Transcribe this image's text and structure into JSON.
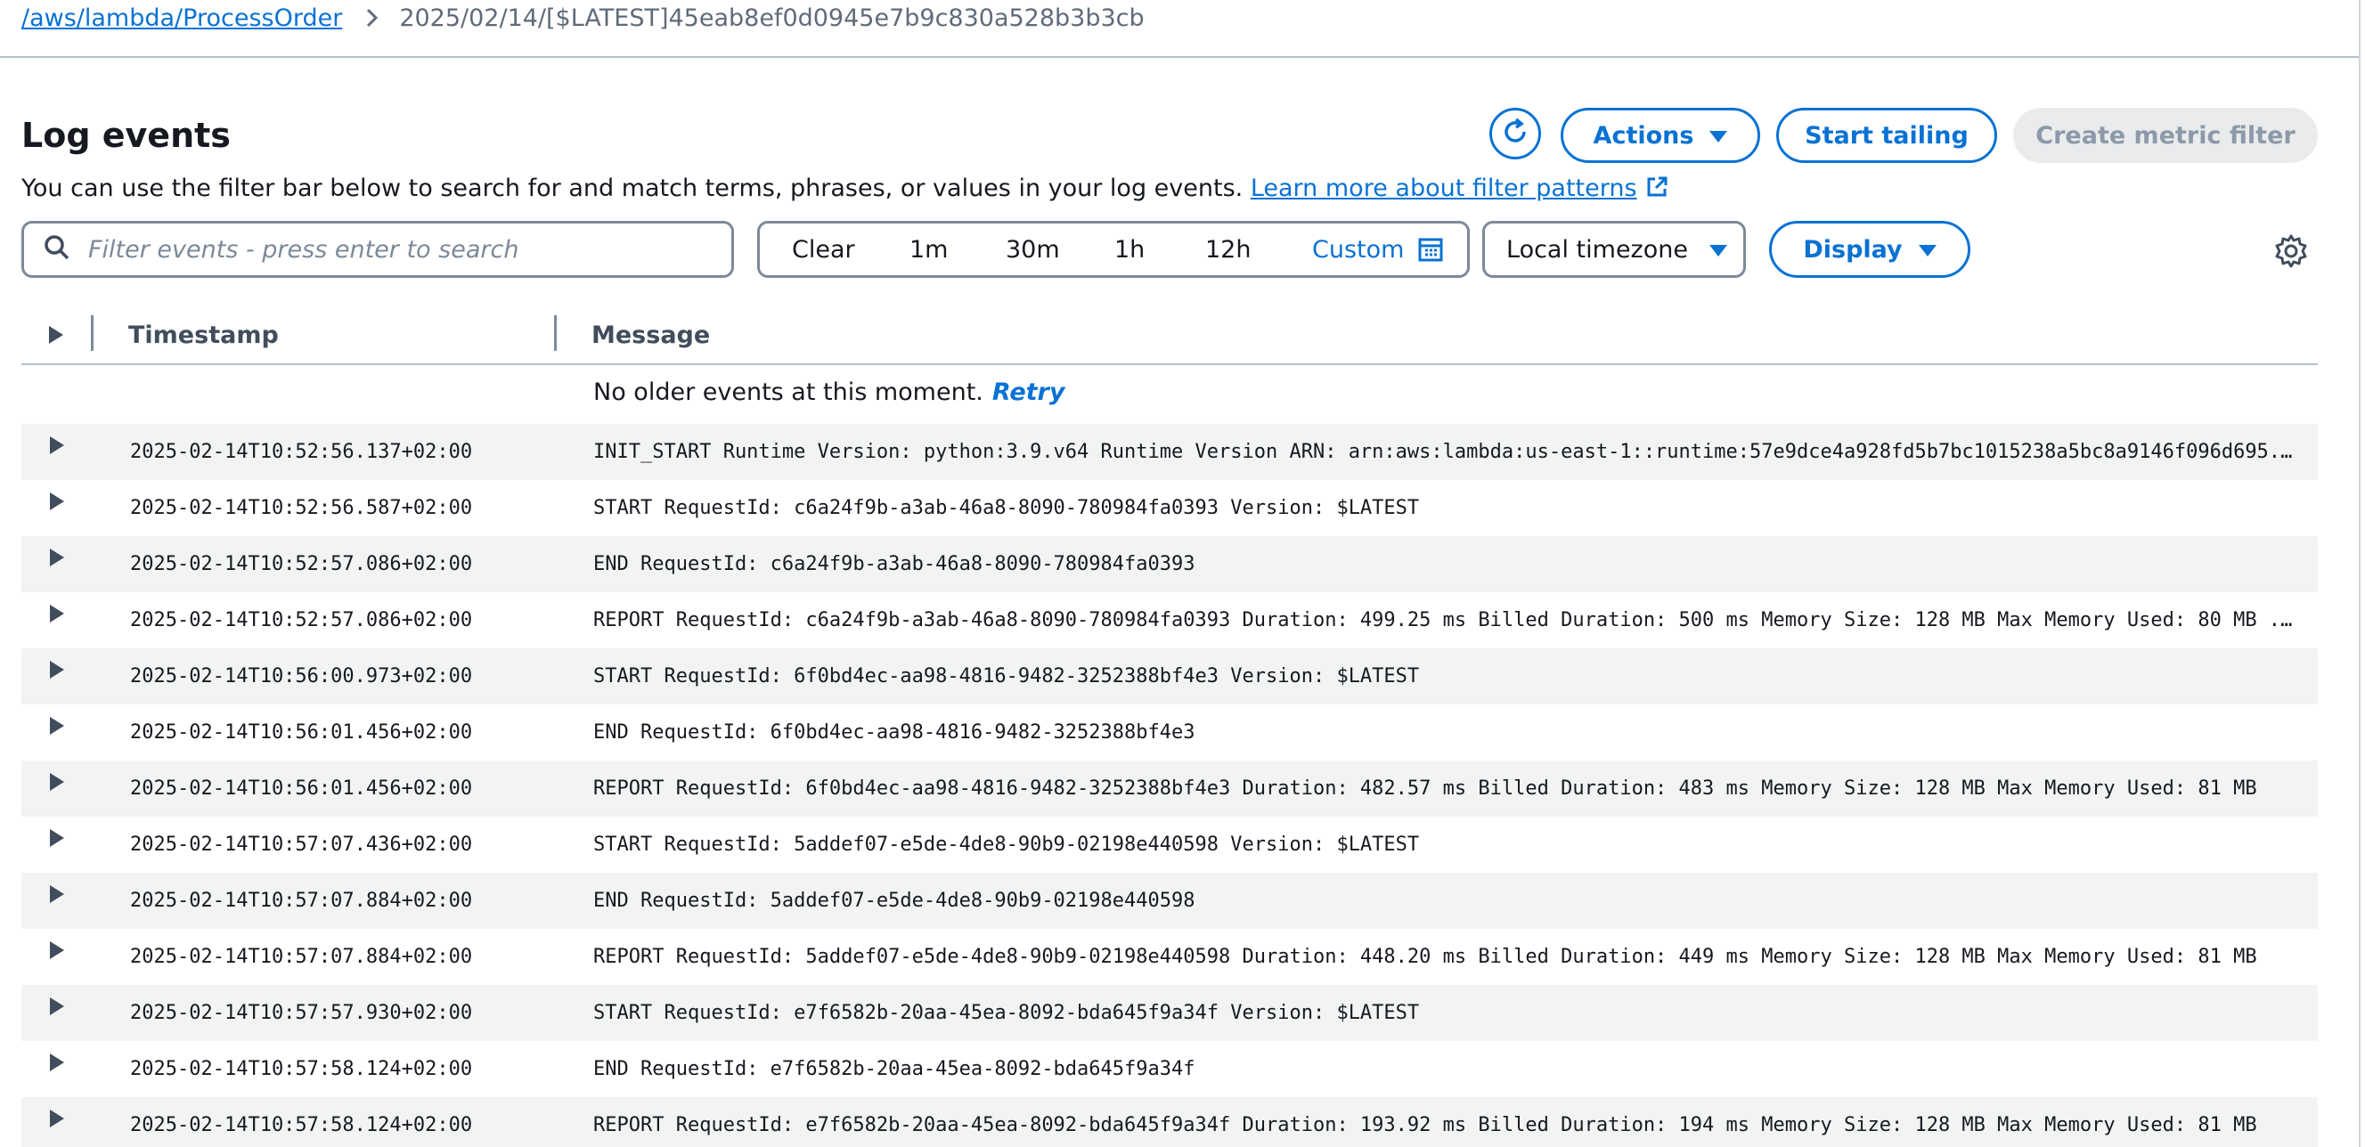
{
  "breadcrumb": {
    "log_group": "/aws/lambda/ProcessOrder",
    "log_stream": "2025/02/14/[$LATEST]45eab8ef0d0945e7b9c830a528b3b3cb"
  },
  "header": {
    "title": "Log events",
    "description": "You can use the filter bar below to search for and match terms, phrases, or values in your log events.",
    "learn_more": "Learn more about filter patterns",
    "actions_label": "Actions",
    "start_tailing_label": "Start tailing",
    "create_metric_filter_label": "Create metric filter"
  },
  "filter": {
    "placeholder": "Filter events - press enter to search",
    "value": "",
    "ranges": {
      "clear": "Clear",
      "r1m": "1m",
      "r30m": "30m",
      "r1h": "1h",
      "r12h": "12h",
      "custom": "Custom"
    },
    "timezone": "Local timezone",
    "display_label": "Display"
  },
  "table": {
    "columns": {
      "timestamp": "Timestamp",
      "message": "Message"
    },
    "status_text": "No older events at this moment.",
    "retry": "Retry",
    "rows": [
      {
        "timestamp": "2025-02-14T10:52:56.137+02:00",
        "message": "INIT_START Runtime Version: python:3.9.v64 Runtime Version ARN: arn:aws:lambda:us-east-1::runtime:57e9dce4a928fd5b7bc1015238a5bc8a9146f096d695..."
      },
      {
        "timestamp": "2025-02-14T10:52:56.587+02:00",
        "message": "START RequestId: c6a24f9b-a3ab-46a8-8090-780984fa0393 Version: $LATEST"
      },
      {
        "timestamp": "2025-02-14T10:52:57.086+02:00",
        "message": "END RequestId: c6a24f9b-a3ab-46a8-8090-780984fa0393"
      },
      {
        "timestamp": "2025-02-14T10:52:57.086+02:00",
        "message": "REPORT RequestId: c6a24f9b-a3ab-46a8-8090-780984fa0393 Duration: 499.25 ms Billed Duration: 500 ms Memory Size: 128 MB Max Memory Used: 80 MB ..."
      },
      {
        "timestamp": "2025-02-14T10:56:00.973+02:00",
        "message": "START RequestId: 6f0bd4ec-aa98-4816-9482-3252388bf4e3 Version: $LATEST"
      },
      {
        "timestamp": "2025-02-14T10:56:01.456+02:00",
        "message": "END RequestId: 6f0bd4ec-aa98-4816-9482-3252388bf4e3"
      },
      {
        "timestamp": "2025-02-14T10:56:01.456+02:00",
        "message": "REPORT RequestId: 6f0bd4ec-aa98-4816-9482-3252388bf4e3 Duration: 482.57 ms Billed Duration: 483 ms Memory Size: 128 MB Max Memory Used: 81 MB"
      },
      {
        "timestamp": "2025-02-14T10:57:07.436+02:00",
        "message": "START RequestId: 5addef07-e5de-4de8-90b9-02198e440598 Version: $LATEST"
      },
      {
        "timestamp": "2025-02-14T10:57:07.884+02:00",
        "message": "END RequestId: 5addef07-e5de-4de8-90b9-02198e440598"
      },
      {
        "timestamp": "2025-02-14T10:57:07.884+02:00",
        "message": "REPORT RequestId: 5addef07-e5de-4de8-90b9-02198e440598 Duration: 448.20 ms Billed Duration: 449 ms Memory Size: 128 MB Max Memory Used: 81 MB"
      },
      {
        "timestamp": "2025-02-14T10:57:57.930+02:00",
        "message": "START RequestId: e7f6582b-20aa-45ea-8092-bda645f9a34f Version: $LATEST"
      },
      {
        "timestamp": "2025-02-14T10:57:58.124+02:00",
        "message": "END RequestId: e7f6582b-20aa-45ea-8092-bda645f9a34f"
      },
      {
        "timestamp": "2025-02-14T10:57:58.124+02:00",
        "message": "REPORT RequestId: e7f6582b-20aa-45ea-8092-bda645f9a34f Duration: 193.92 ms Billed Duration: 194 ms Memory Size: 128 MB Max Memory Used: 81 MB"
      }
    ]
  },
  "colors": {
    "link": "#0972d3",
    "text": "#16191f",
    "muted": "#5f6b7a",
    "border": "#7d8998",
    "row_shade": "#f2f3f3",
    "disabled_bg": "#e9ebed",
    "disabled_text": "#8d99a8"
  },
  "icons": {
    "refresh": "refresh-icon",
    "caret": "caret-down-icon",
    "search": "search-icon",
    "calendar": "calendar-icon",
    "external": "external-link-icon",
    "settings": "gear-icon",
    "expand": "expand-triangle-icon",
    "chevron": "chevron-right-icon"
  }
}
